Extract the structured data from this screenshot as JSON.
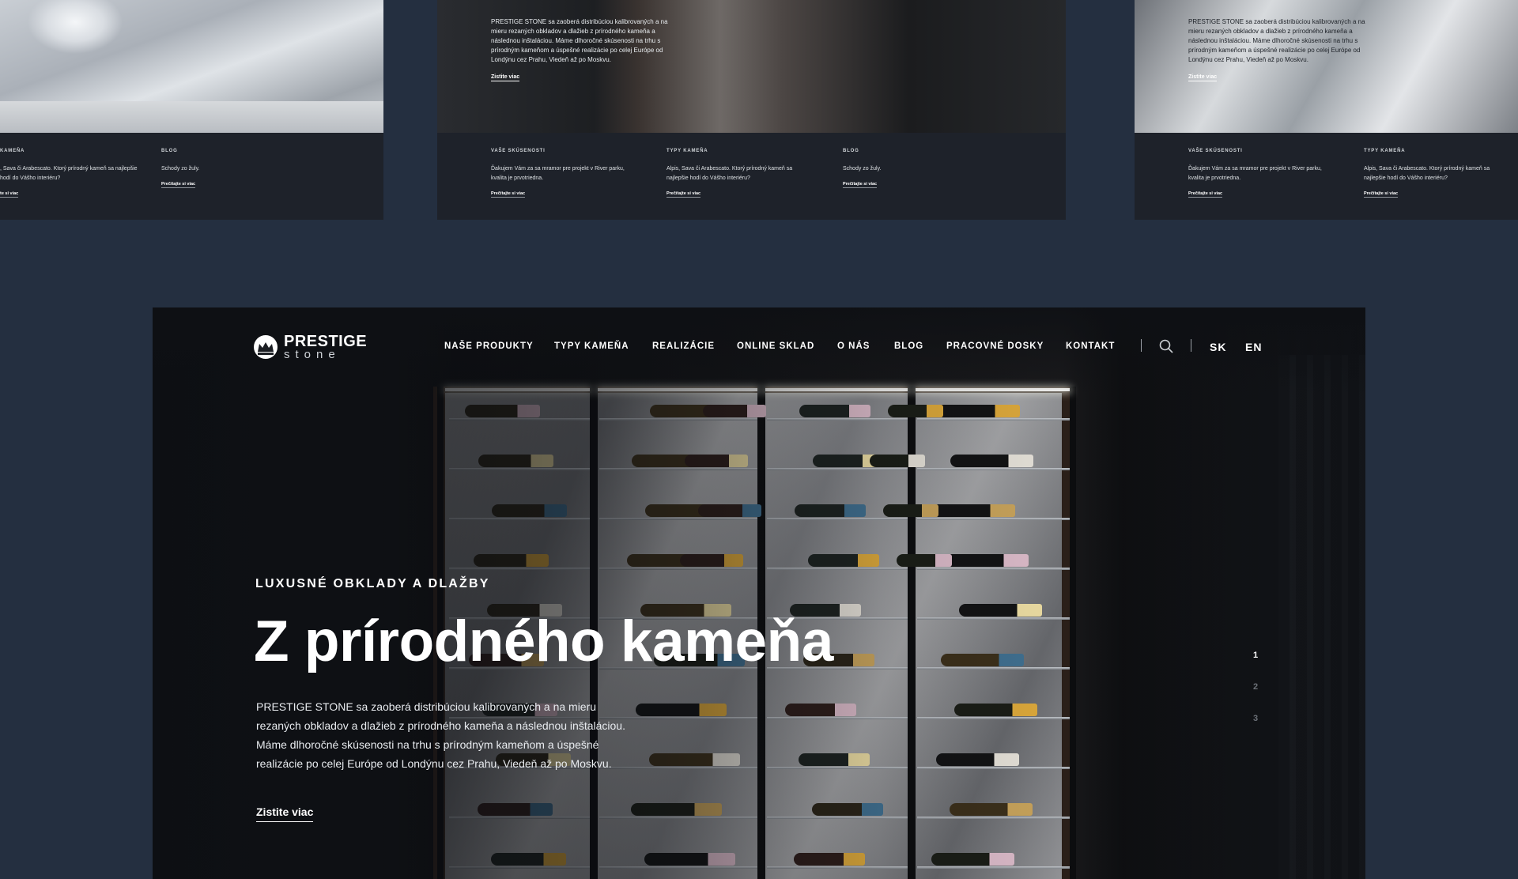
{
  "cards": {
    "left": {
      "columns": [
        {
          "heading": "KAMEŇA",
          "text": ", Sava či Arabescato. Ktorý prírodný kameň sa najlepšie hodí do Vášho interiéru?",
          "link": "te si viac"
        },
        {
          "heading": "BLOG",
          "text": "Schody zo žuly.",
          "link": "Prečítajte si viac"
        }
      ]
    },
    "middle": {
      "hero_text": "PRESTIGE STONE sa zaoberá distribúciou kalibrovaných a na mieru rezaných obkladov a dlažieb z prírodného kameňa a následnou inštaláciou. Máme dlhoročné skúsenosti na trhu s prírodným kameňom a úspešné realizácie po celej Európe od Londýnu cez Prahu, Viedeň až po Moskvu.",
      "hero_link": "Zistite viac",
      "columns": [
        {
          "heading": "VAŠE SKÚSENOSTI",
          "text": "Ďakujem Vám za sa mramor pre projekt v River parku, kvalita je prvotriedna.",
          "link": "Prečítajte si viac"
        },
        {
          "heading": "TYPY KAMEŇA",
          "text": "Alpis, Sava či Arabescato. Ktorý prírodný kameň sa najlepšie hodí do Vášho interiéru?",
          "link": "Prečítajte si viac"
        },
        {
          "heading": "BLOG",
          "text": "Schody zo žuly.",
          "link": "Prečítajte si viac"
        }
      ]
    },
    "right": {
      "hero_text": "PRESTIGE STONE sa zaoberá distribúciou kalibrovaných a na mieru rezaných obkladov a dlažieb z prírodného kameňa a následnou inštaláciou. Máme dlhoročné skúsenosti na trhu s prírodným kameňom a úspešné realizácie po celej Európe od Londýnu cez Prahu, Viedeň až po Moskvu.",
      "hero_link": "Zistite viac",
      "columns": [
        {
          "heading": "VAŠE SKÚSENOSTI",
          "text": "Ďakujem Vám za sa mramor pre projekt v River parku, kvalita je prvotriedna.",
          "link": "Prečítajte si viac"
        },
        {
          "heading": "TYPY KAMEŇA",
          "text": "Alpis, Sava či Arabescato. Ktorý prírodný kameň sa najlepšie hodí do Vášho interiéru?",
          "link": "Prečítajte si viac"
        }
      ]
    }
  },
  "main": {
    "logo": {
      "line1": "PRESTIGE",
      "line2": "stone"
    },
    "nav": [
      "NAŠE PRODUKTY",
      "TYPY KAMEŇA",
      "REALIZÁCIE",
      "ONLINE SKLAD",
      "O NÁS",
      "BLOG",
      "PRACOVNÉ DOSKY",
      "KONTAKT"
    ],
    "search_icon": "search-icon",
    "languages": [
      "SK",
      "EN"
    ],
    "kicker": "LUXUSNÉ OBKLADY A DLAŽBY",
    "title": "Z prírodného kameňa",
    "description": "PRESTIGE STONE sa zaoberá distribúciou kalibrovaných a na mieru rezaných obkladov a dlažieb z prírodného kameňa a následnou inštaláciou. Máme dlhoročné skúsenosti na trhu s prírodným kameňom a úspešné realizácie po celej Európe od Londýnu cez Prahu, Viedeň až po Moskvu.",
    "cta": "Zistite viac",
    "pager": [
      "1",
      "2",
      "3"
    ]
  },
  "colors": {
    "page_bg": "#242f40",
    "text": "#ffffff"
  }
}
